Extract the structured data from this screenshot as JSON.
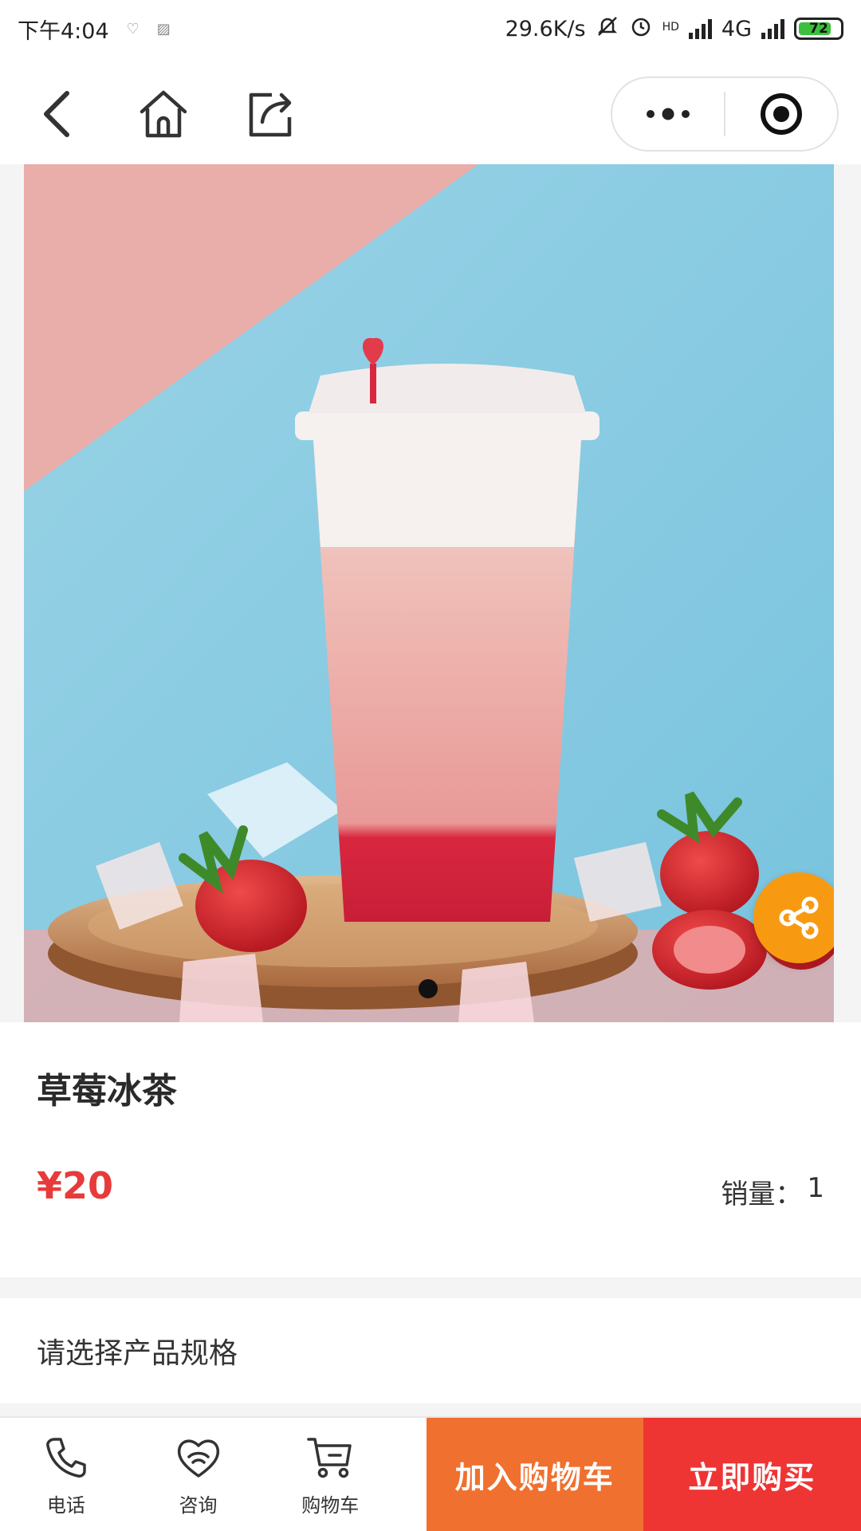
{
  "status_bar": {
    "time": "下午4:04",
    "net_speed": "29.6K/s",
    "network": "4G",
    "hd_label": "HD",
    "battery": "72"
  },
  "nav": {
    "back_icon": "back-arrow-icon",
    "home_icon": "home-icon",
    "share_icon": "share-out-icon",
    "more_icon": "more-dots-icon",
    "close_icon": "target-close-icon"
  },
  "product": {
    "name": "草莓冰茶",
    "price": "¥20",
    "sales_label": "销量：",
    "sales_count": "1",
    "image_count": 1,
    "active_image": 1
  },
  "spec": {
    "prompt": "请选择产品规格"
  },
  "bottom_bar": {
    "tabs": [
      {
        "label": "电话",
        "icon": "phone-icon"
      },
      {
        "label": "咨询",
        "icon": "chat-heart-icon"
      },
      {
        "label": "购物车",
        "icon": "cart-icon"
      }
    ],
    "add_to_cart": "加入购物车",
    "buy_now": "立即购买"
  },
  "colors": {
    "price": "#e83a3a",
    "add_to_cart_bg": "#f0702f",
    "buy_now_bg": "#ef3434",
    "share_fab": "#f79a12"
  }
}
